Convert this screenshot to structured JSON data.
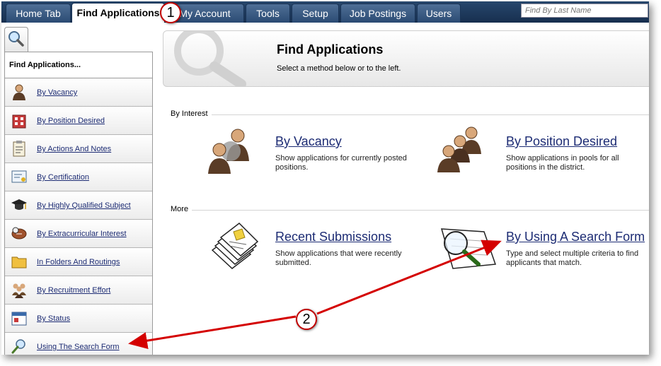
{
  "nav": {
    "tabs": [
      {
        "label": "Home Tab"
      },
      {
        "label": "Find Applications"
      },
      {
        "label": "My Account"
      },
      {
        "label": "Tools"
      },
      {
        "label": "Setup"
      },
      {
        "label": "Job Postings"
      },
      {
        "label": "Users"
      }
    ],
    "active_tab": "Find Applications",
    "search_placeholder": "Find By Last Name"
  },
  "sidebar": {
    "heading": "Find Applications...",
    "items": [
      {
        "label": "By Vacancy",
        "icon": "person-icon"
      },
      {
        "label": "By Position Desired",
        "icon": "building-icon"
      },
      {
        "label": "By Actions And Notes",
        "icon": "clipboard-icon"
      },
      {
        "label": "By Certification",
        "icon": "certificate-icon"
      },
      {
        "label": "By Highly Qualified Subject",
        "icon": "graduation-cap-icon"
      },
      {
        "label": "By Extracurricular Interest",
        "icon": "sports-ball-icon"
      },
      {
        "label": "In Folders And Routings",
        "icon": "folder-icon"
      },
      {
        "label": "By Recruitment Effort",
        "icon": "people-group-icon"
      },
      {
        "label": "By Status",
        "icon": "calendar-icon"
      },
      {
        "label": "Using The Search Form",
        "icon": "magnifier-icon"
      }
    ]
  },
  "main": {
    "title": "Find Applications",
    "subtitle": "Select a method below or to the left.",
    "sections": [
      {
        "label": "By Interest"
      },
      {
        "label": "More"
      }
    ],
    "options": [
      {
        "title": "By Vacancy",
        "desc_line1": "Show applications for currently posted",
        "desc_line2": "positions.",
        "icon": "people-icon"
      },
      {
        "title": "By Position Desired",
        "desc_line1": "Show applications in pools for all",
        "desc_line2": "positions in the district.",
        "icon": "group-icon"
      },
      {
        "title": "Recent Submissions",
        "desc_line1": "Show applications that were recently",
        "desc_line2": "submitted.",
        "icon": "documents-stack-icon"
      },
      {
        "title": "By Using A Search Form",
        "desc_line1": "Type and select multiple criteria to find",
        "desc_line2": "applicants that match.",
        "icon": "search-form-icon"
      }
    ]
  },
  "annotations": {
    "callout_1": "1",
    "callout_2": "2",
    "arrow_color": "#d40000"
  }
}
